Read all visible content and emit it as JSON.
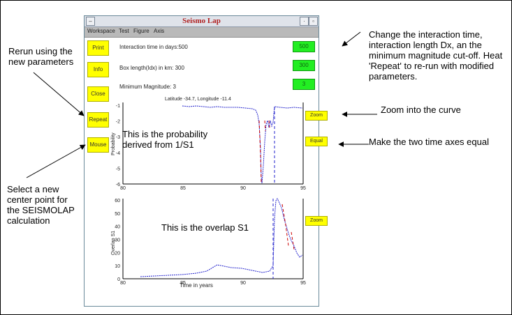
{
  "window": {
    "title": "Seismo Lap",
    "menu": [
      "Workspace",
      "Test",
      "Figure",
      "Axis"
    ]
  },
  "left_buttons": [
    "Print",
    "Info",
    "Close",
    "Repeat",
    "Mouse"
  ],
  "params": [
    {
      "label": "Interaction time in days:500",
      "value": "500"
    },
    {
      "label": "Box length(Idx) in km: 300",
      "value": "300"
    },
    {
      "label": "Minimum Magnitude: 3",
      "value": "3"
    }
  ],
  "top_plot": {
    "header": "Latitude -34.7, Longitude -11.4",
    "ylabel": "Probability",
    "yticks": [
      "-1",
      "-2",
      "-3",
      "-4",
      "-5",
      "-6"
    ],
    "xticks": [
      "80",
      "85",
      "90",
      "95"
    ],
    "overlay_text": "This is the probability derived from 1/S1",
    "zoom_label": "Zoom",
    "equal_label": "Equal"
  },
  "bottom_plot": {
    "ylabel": "Overlap S1",
    "xlabel": "Time in years",
    "yticks": [
      "60",
      "50",
      "40",
      "30",
      "20",
      "10",
      "0"
    ],
    "xticks": [
      "80",
      "85",
      "90",
      "95"
    ],
    "overlay_text": "This is the overlap S1",
    "zoom_label": "Zoom"
  },
  "annotations": {
    "rerun": "Rerun using the new parameters",
    "change": "Change the interaction time, interaction length Dx, an the minimum magnitude cut-off. Heat 'Repeat' to re-run with modified parameters.",
    "zoom": "Zoom into the curve",
    "equal": "Make the two time axes equal",
    "select": "Select a new center point for the SEISMOLAP calculation"
  },
  "colors": {
    "curve": "#2222cc",
    "highlight": "#cc0000",
    "button": "#ffff00",
    "value_box": "#22ee22"
  }
}
